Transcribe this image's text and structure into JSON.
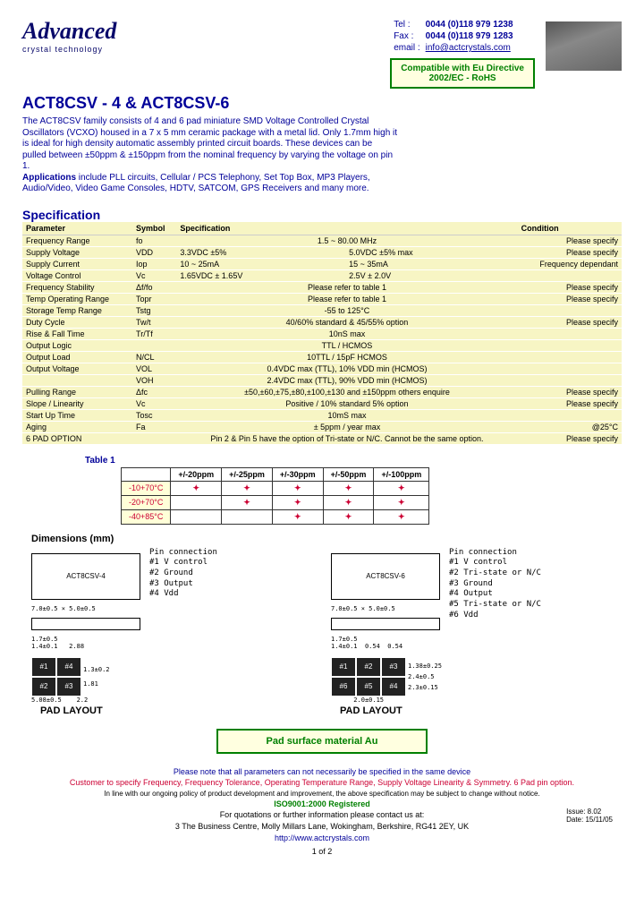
{
  "header": {
    "logo_text": "Advanced",
    "tagline": "crystal technology",
    "contact": {
      "tel_label": "Tel :",
      "tel": "0044 (0)118 979 1238",
      "fax_label": "Fax :",
      "fax": "0044 (0)118 979 1283",
      "email_label": "email :",
      "email": "info@actcrystals.com"
    },
    "rohs_line1": "Compatible with Eu Directive",
    "rohs_line2": "2002/EC - RoHS"
  },
  "title": "ACT8CSV - 4  & ACT8CSV-6",
  "description_p1": "The ACT8CSV family consists of 4 and 6 pad miniature SMD Voltage Controlled Crystal Oscillators (VCXO) housed in a 7 x 5 mm ceramic package with a metal lid. Only 1.7mm high it is ideal for high density automatic assembly printed circuit boards. These devices can be pulled between ±50ppm & ±150ppm from the nominal frequency by varying the voltage on pin 1.",
  "description_apps_label": "Applications",
  "description_apps": " include PLL circuits, Cellular / PCS Telephony, Set Top Box, MP3 Players, Audio/Video, Video Game Consoles, HDTV, SATCOM, GPS Receivers and many more.",
  "spec_title": "Specification",
  "spec_headers": [
    "Parameter",
    "Symbol",
    "Specification",
    "",
    "Condition"
  ],
  "spec_rows": [
    [
      "Frequency Range",
      "fo",
      "1.5 ~ 80.00 MHz",
      "",
      "Please specify"
    ],
    [
      "Supply Voltage",
      "VDD",
      "3.3VDC ±5%",
      "5.0VDC ±5% max",
      "Please specify"
    ],
    [
      "Supply Current",
      "Iop",
      "10 ~ 25mA",
      "15 ~ 35mA",
      "Frequency dependant"
    ],
    [
      "Voltage Control",
      "Vc",
      "1.65VDC ± 1.65V",
      "2.5V ± 2.0V",
      ""
    ],
    [
      "Frequency Stability",
      "Δf/fo",
      "Please refer to table 1",
      "",
      "Please specify"
    ],
    [
      "Temp Operating Range",
      "Topr",
      "Please refer to table 1",
      "",
      "Please specify"
    ],
    [
      "Storage Temp Range",
      "Tstg",
      "-55 to 125°C",
      "",
      ""
    ],
    [
      "Duty Cycle",
      "Tw/t",
      "40/60% standard  &  45/55% option",
      "",
      "Please specify"
    ],
    [
      "Rise & Fall Time",
      "Tr/Tf",
      "10nS max",
      "",
      ""
    ],
    [
      "Output Logic",
      "",
      "TTL / HCMOS",
      "",
      ""
    ],
    [
      "Output Load",
      "N/CL",
      "10TTL / 15pF HCMOS",
      "",
      ""
    ],
    [
      "Output Voltage",
      "VOL",
      "0.4VDC max (TTL), 10% VDD min (HCMOS)",
      "",
      ""
    ],
    [
      "",
      "VOH",
      "2.4VDC max (TTL), 90% VDD min (HCMOS)",
      "",
      ""
    ],
    [
      "Pulling Range",
      "Δfc",
      "±50,±60,±75,±80,±100,±130 and ±150ppm others enquire",
      "",
      "Please specify"
    ],
    [
      "Slope / Linearity",
      "Vc",
      "Positive / 10% standard 5% option",
      "",
      "Please specify"
    ],
    [
      "Start Up Time",
      "Tosc",
      "10mS max",
      "",
      ""
    ],
    [
      "Aging",
      "Fa",
      "± 5ppm / year max",
      "",
      "@25°C"
    ],
    [
      "6 PAD OPTION",
      "",
      "Pin 2 & Pin 5 have the option of Tri-state or N/C. Cannot be the same option.",
      "",
      "Please specify"
    ]
  ],
  "table1": {
    "title": "Table 1",
    "col_headers": [
      "+/-20ppm",
      "+/-25ppm",
      "+/-30ppm",
      "+/-50ppm",
      "+/-100ppm"
    ],
    "rows": [
      {
        "range": "-10+70°C",
        "marks": [
          "+",
          "+",
          "+",
          "+",
          "+"
        ]
      },
      {
        "range": "-20+70°C",
        "marks": [
          "",
          "+",
          "+",
          "+",
          "+"
        ]
      },
      {
        "range": "-40+85°C",
        "marks": [
          "",
          "",
          "+",
          "+",
          "+"
        ]
      }
    ]
  },
  "dimensions": {
    "title": "Dimensions (mm)",
    "chip4_label": "ACT8CSV-4",
    "chip6_label": "ACT8CSV-6",
    "pinconn_title": "Pin connection",
    "pins4": [
      "#1  V control",
      "#2  Ground",
      "#3  Output",
      "#4  Vdd"
    ],
    "pins6": [
      "#1 V control",
      "#2 Tri-state or N/C",
      "#3 Ground",
      "#4 Output",
      "#5 Tri-state or N/C",
      "#6 Vdd"
    ],
    "dim_w": "7.0±0.5",
    "dim_h": "5.0±0.5",
    "dim_t": "1.7±0.5",
    "pads4": [
      "#1",
      "#4",
      "#2",
      "#3"
    ],
    "pads6": [
      "#1",
      "#2",
      "#3",
      "#6",
      "#5",
      "#4"
    ],
    "pad_label": "PAD LAYOUT",
    "pad_dims": {
      "a": "1.4±0.1",
      "b": "2.88",
      "c": "5.08±0.5",
      "d": "2.2",
      "e": "1.81",
      "f": "0.54",
      "g": "2.0±0.15",
      "h": "1.38±0.25",
      "i": "2.3±0.15",
      "j": "2.4±0.5",
      "k": "1.3±0.2"
    }
  },
  "pad_surface": "Pad surface material Au",
  "notes": {
    "l1": "Please note that all parameters can not necessarily be specified in the same device",
    "l2": "Customer to specify Frequency, Frequency Tolerance, Operating Temperature Range, Supply Voltage Linearity & Symmetry. 6 Pad pin option.",
    "l3": "In line with our ongoing policy of product development and improvement, the above specification may be subject to change without notice.",
    "iso": "ISO9001:2000 Registered",
    "l4": "For quotations or further information please contact us at:",
    "addr": "3 The Business Centre, Molly Millars Lane, Wokingham, Berkshire, RG41 2EY, UK",
    "url": "http://www.actcrystals.com"
  },
  "issue": {
    "no": "Issue: 8.02",
    "date": "Date: 15/11/05"
  },
  "page": "1 of 2"
}
